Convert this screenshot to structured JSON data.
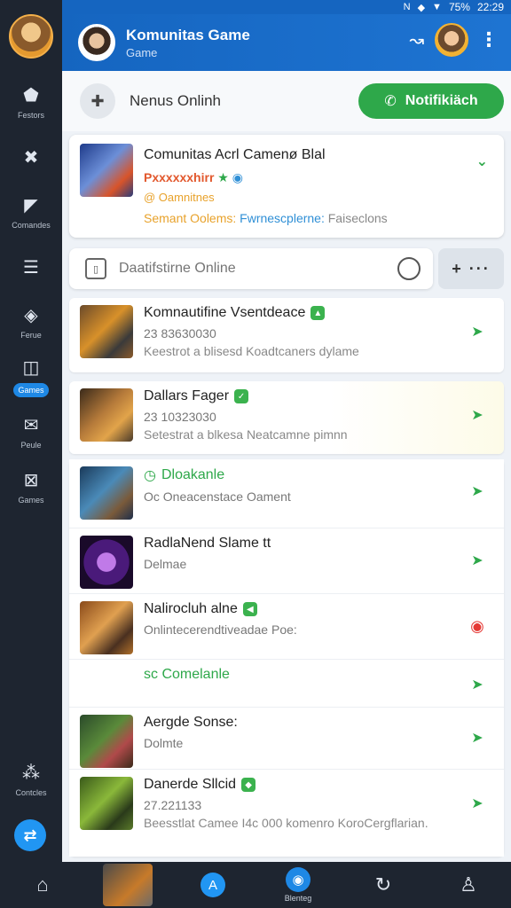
{
  "status": {
    "time": "22:29",
    "signal": "75%"
  },
  "rail": {
    "items": [
      {
        "label": "Festors",
        "icon": "flag-icon"
      },
      {
        "label": "",
        "icon": "tools-icon"
      },
      {
        "label": "Comandes",
        "icon": "shield-icon"
      },
      {
        "label": "",
        "icon": "list-icon"
      },
      {
        "label": "Ferue",
        "icon": "badge-icon"
      },
      {
        "label": "Games",
        "icon": "controller-icon",
        "active": true
      },
      {
        "label": "Peule",
        "icon": "mail-icon"
      },
      {
        "label": "Games",
        "icon": "mailbox-icon"
      },
      {
        "label": "Contcles",
        "icon": "dots-icon"
      }
    ]
  },
  "header": {
    "title": "Komunitas Game",
    "subtitle": "Game"
  },
  "toprow": {
    "label": "Nenus Onlinh",
    "notif_label": "Notifikiäch"
  },
  "featured": {
    "title": "Comunitas Acrl Camenø Blal",
    "line2": "Pxxxxxxhirr",
    "line3": "@ Oamnitnes",
    "line4a": "Semant Oolems:",
    "line4b": "Fwrnescplerne:",
    "line4c": "Faiseclons"
  },
  "search": {
    "placeholder": "Daatifstirne Online",
    "filter_label": "+ ···"
  },
  "items": [
    {
      "title": "Komnautifine Vsentdeace",
      "sub": "23 83630030",
      "desc": "Keestrot a blisesd Koadtcaners dylame",
      "style": ""
    },
    {
      "title": "Dallars Fager",
      "sub": "23 10323030",
      "desc": "Setestrat a blkesa Neatcamne pimnn",
      "style": ""
    },
    {
      "title": "Dloakanle",
      "sub": "",
      "desc": "Oc Oneacenstace Oament",
      "style": "green"
    },
    {
      "title": "RadlaNend Slame tt",
      "sub": "",
      "desc": "Delmae",
      "style": ""
    },
    {
      "title": "Nalirocluh alne",
      "sub": "",
      "desc": "Onlintecerendtiveadae Poe:",
      "style": ""
    },
    {
      "title": "sc Comelanle",
      "sub": "",
      "desc": "",
      "style": "green"
    },
    {
      "title": "Aergde Sonse:",
      "sub": "",
      "desc": "Dolmte",
      "style": ""
    },
    {
      "title": "Danerde Sllcid",
      "sub": "27.221133",
      "desc": "Beesstlat Camee I4c 000 komenro KoroCergflarian.",
      "style": ""
    }
  ],
  "bottomnav": {
    "active_label": "Blenteg"
  },
  "colors": {
    "accent": "#1565c0",
    "green": "#2ea84a",
    "rail": "#1e2530"
  }
}
